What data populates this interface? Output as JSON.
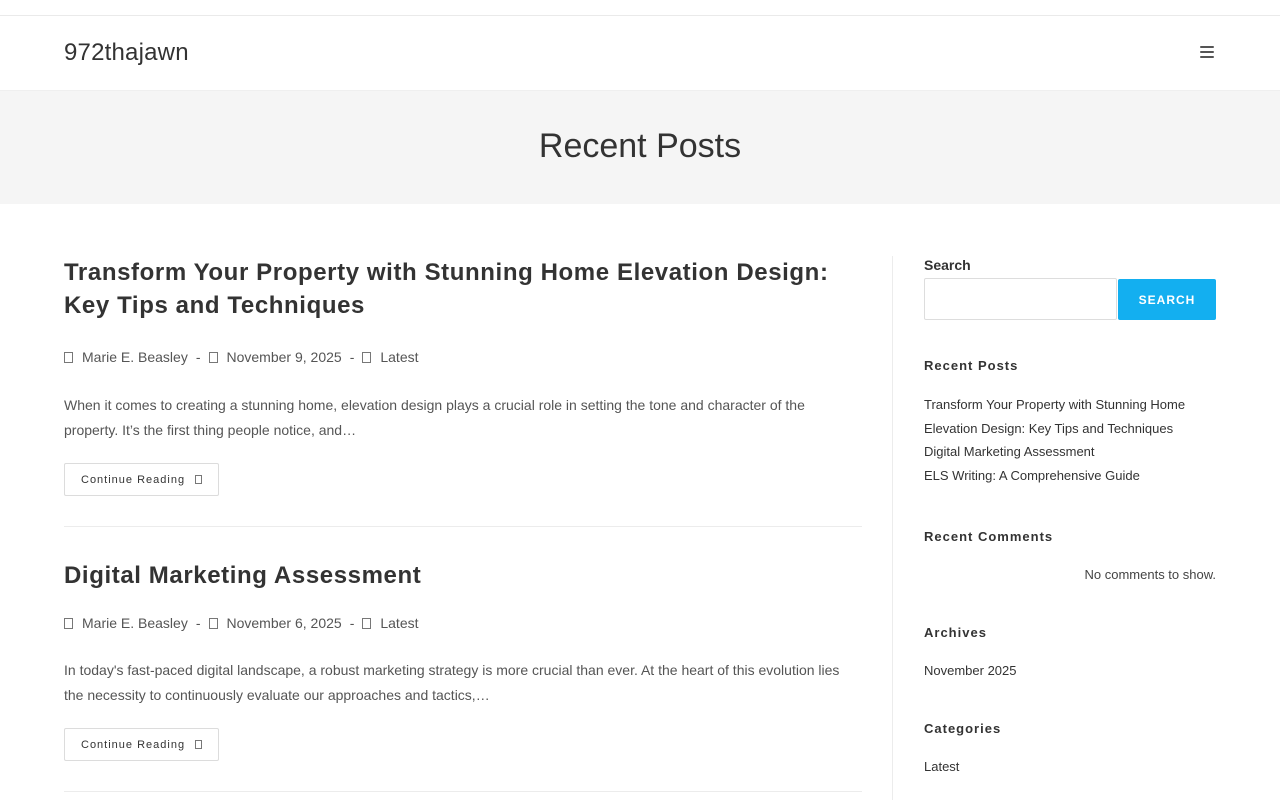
{
  "site": {
    "title": "972thajawn",
    "menu_icon": "hamburger-icon"
  },
  "hero": {
    "title": "Recent Posts"
  },
  "posts": [
    {
      "title": "Transform Your Property with Stunning Home Elevation Design: Key Tips and Techniques",
      "author": "Marie E. Beasley",
      "date": "November 9, 2025",
      "category": "Latest",
      "excerpt": "When it comes to creating a stunning home, elevation design plays a crucial role in setting the tone and character of the property. It’s the first thing people notice, and…",
      "button": "Continue Reading"
    },
    {
      "title": "Digital Marketing Assessment",
      "author": "Marie E. Beasley",
      "date": "November 6, 2025",
      "category": "Latest",
      "excerpt": "In today's fast-paced digital landscape, a robust marketing strategy is more crucial than ever. At the heart of this evolution lies the necessity to continuously evaluate our approaches and tactics,…",
      "button": "Continue Reading"
    }
  ],
  "sidebar": {
    "search": {
      "label": "Search",
      "value": "",
      "button": "SEARCH"
    },
    "recent_posts": {
      "title": "Recent Posts",
      "items": [
        "Transform Your Property with Stunning Home Elevation Design: Key Tips and Techniques",
        "Digital Marketing Assessment",
        "ELS Writing: A Comprehensive Guide"
      ]
    },
    "recent_comments": {
      "title": "Recent Comments",
      "empty": "No comments to show."
    },
    "archives": {
      "title": "Archives",
      "items": [
        "November 2025"
      ]
    },
    "categories": {
      "title": "Categories",
      "items": [
        "Latest"
      ]
    }
  },
  "colors": {
    "accent": "#13aff0",
    "hero_bg": "#f5f5f5"
  }
}
